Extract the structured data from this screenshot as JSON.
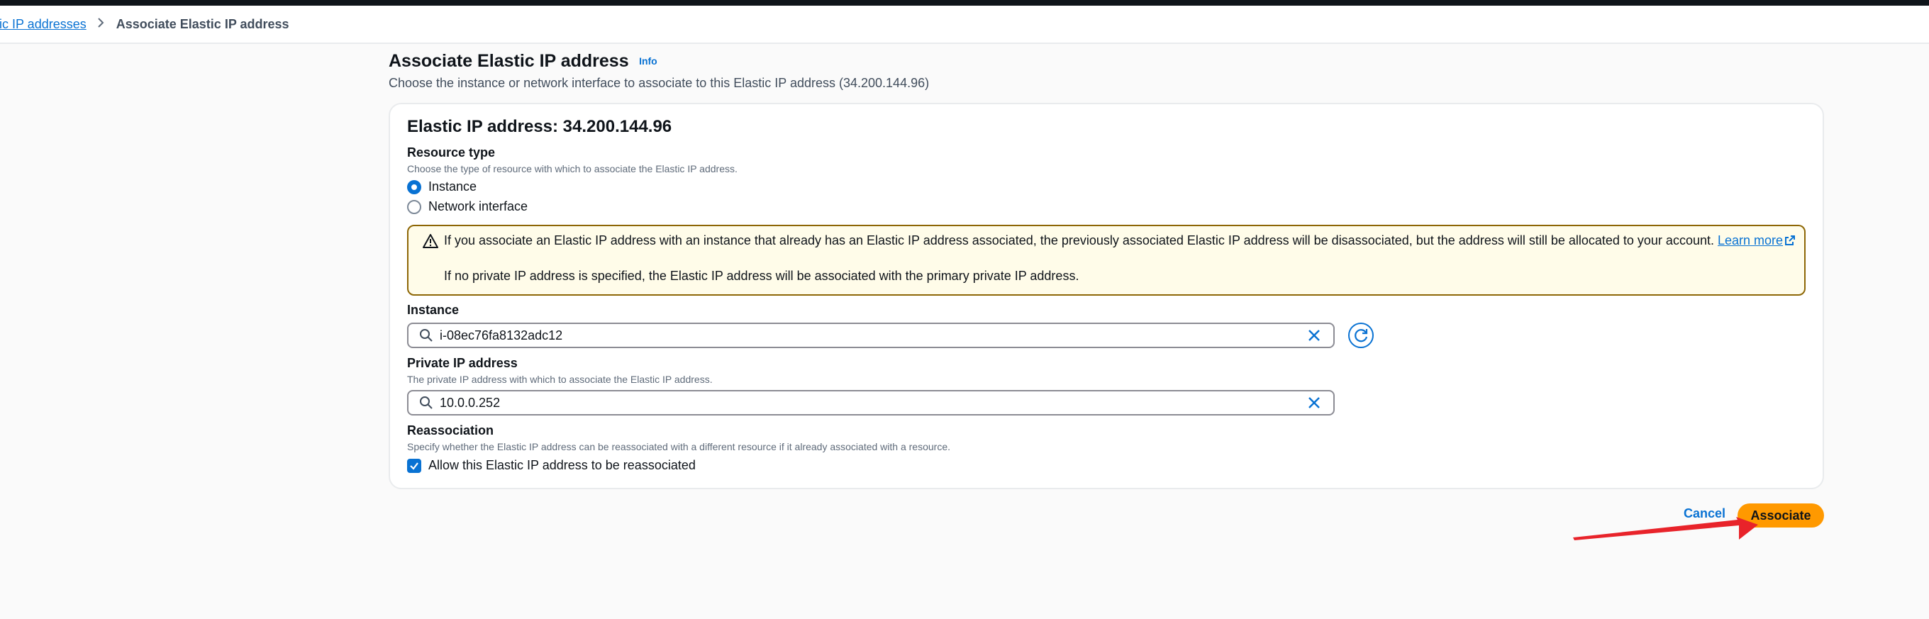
{
  "breadcrumb": {
    "parent": "tic IP addresses",
    "current": "Associate Elastic IP address"
  },
  "header": {
    "title": "Associate Elastic IP address",
    "info": "Info",
    "description": "Choose the instance or network interface to associate to this Elastic IP address (34.200.144.96)"
  },
  "card": {
    "title": "Elastic IP address: 34.200.144.96",
    "resource_type": {
      "label": "Resource type",
      "hint": "Choose the type of resource with which to associate the Elastic IP address.",
      "options": [
        "Instance",
        "Network interface"
      ],
      "selected": "Instance"
    },
    "alert": {
      "text1": "If you associate an Elastic IP address with an instance that already has an Elastic IP address associated, the previously associated Elastic IP address will be disassociated, but the address will still be allocated to your account.",
      "learn_more": "Learn more",
      "text2": "If no private IP address is specified, the Elastic IP address will be associated with the primary private IP address."
    },
    "instance": {
      "label": "Instance",
      "value": "i-08ec76fa8132adc12"
    },
    "private_ip": {
      "label": "Private IP address",
      "hint": "The private IP address with which to associate the Elastic IP address.",
      "value": "10.0.0.252"
    },
    "reassociation": {
      "label": "Reassociation",
      "hint": "Specify whether the Elastic IP address can be reassociated with a different resource if it already associated with a resource.",
      "checkbox_label": "Allow this Elastic IP address to be reassociated",
      "checked": true
    }
  },
  "actions": {
    "cancel": "Cancel",
    "associate": "Associate"
  },
  "colors": {
    "accent": "#0972d3",
    "primary_button": "#ff9900",
    "warning_border": "#8d6605",
    "warning_bg": "#fffce9",
    "annotation_arrow": "#e8232a"
  }
}
